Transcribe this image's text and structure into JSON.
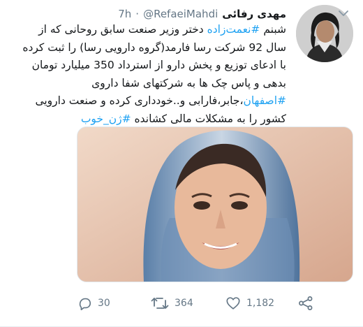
{
  "author": {
    "name": "مهدی رفائی",
    "handle": "@RefaeiMahdi",
    "separator": "·",
    "time": "7h"
  },
  "tweet": {
    "line1": {
      "pre": "شبنم ",
      "tag": "#نعمت‌زاده",
      "post": " دختر وزیر صنعت سابق روحانی که از"
    },
    "line2": "سال 92 شرکت رسا فارمد(گروه دارویی رسا) را ثبت کرده",
    "line3": "با ادعای توزیع و پخش دارو از استرداد 350 میلیارد تومان",
    "line4": "بدهی و پاس چک ها به شرکتهای شفا داروی",
    "line5": {
      "tag": "#اصفهان",
      "post": "،جابر،فارابی و..خودداری کرده و صنعت دارویی"
    },
    "line6": {
      "pre": "کشور را به مشکلات مالی کشانده ",
      "tag": "#ژن_خوب"
    }
  },
  "stats": {
    "replies": "30",
    "retweets": "364",
    "likes": "1,182"
  },
  "icons": {
    "chevron": "chevron-down-icon",
    "reply": "reply-icon",
    "retweet": "retweet-icon",
    "like": "heart-icon",
    "share": "share-icon"
  },
  "colors": {
    "hashtag": "#1da1f2",
    "muted": "#657786",
    "text": "#14171a"
  }
}
